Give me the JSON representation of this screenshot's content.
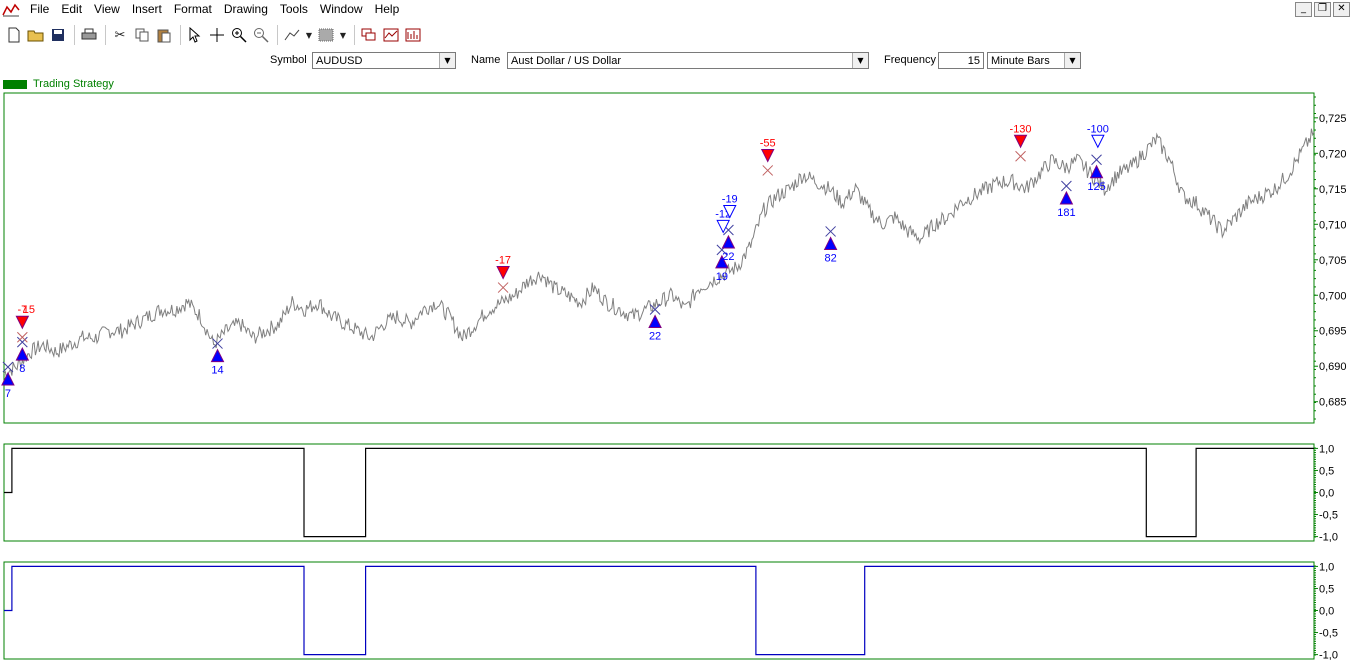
{
  "app": {
    "title_icon": "chart-app-icon"
  },
  "menu": {
    "items": [
      {
        "label": "File"
      },
      {
        "label": "Edit"
      },
      {
        "label": "View"
      },
      {
        "label": "Insert"
      },
      {
        "label": "Format"
      },
      {
        "label": "Drawing"
      },
      {
        "label": "Tools"
      },
      {
        "label": "Window"
      },
      {
        "label": "Help"
      }
    ]
  },
  "window_controls": {
    "minimize": "_",
    "restore": "❐",
    "close": "✕"
  },
  "symbol_bar": {
    "symbol_label": "Symbol",
    "symbol_value": "AUDUSD",
    "name_label": "Name",
    "name_value": "Aust Dollar / US Dollar",
    "frequency_label": "Frequency",
    "frequency_value": "15",
    "bar_type_value": "Minute Bars"
  },
  "strategy": {
    "label": "Trading Strategy",
    "color": "#008000"
  },
  "colors": {
    "price": "#808080",
    "frame": "#008000",
    "buy": "#0000ff",
    "sell": "#ff0000",
    "indicator1": "#000000",
    "indicator2": "#0000c0"
  },
  "chart_data": [
    {
      "type": "line",
      "name": "price",
      "y_ticks": [
        "0,725",
        "0,720",
        "0,715",
        "0,710",
        "0,705",
        "0,700",
        "0,695",
        "0,690",
        "0,685"
      ],
      "ylim": [
        0.682,
        0.7285
      ],
      "x_index_range": [
        0,
        100
      ],
      "series": [
        {
          "x": [
            0,
            1,
            2,
            3,
            4,
            5,
            6,
            7,
            8,
            9,
            10,
            11,
            12,
            13,
            14,
            15,
            16,
            17,
            18,
            19,
            20,
            21,
            22,
            23,
            24,
            25,
            26,
            27,
            28,
            29,
            30,
            31,
            32,
            33,
            34,
            35,
            36,
            37,
            38,
            39,
            40,
            41,
            42,
            43,
            44,
            45,
            46,
            47,
            48,
            49,
            50,
            51,
            52,
            53,
            54,
            55,
            56,
            57,
            58,
            59,
            60,
            61,
            62,
            63,
            64,
            65,
            66,
            67,
            68,
            69,
            70,
            71,
            72,
            73,
            74,
            75,
            76,
            77,
            78,
            79,
            80,
            81,
            82,
            83,
            84,
            85,
            86,
            87,
            88,
            89,
            90,
            91,
            92,
            93,
            94,
            95,
            96,
            97,
            98,
            99,
            100
          ],
          "values": [
            0.689,
            0.69,
            0.692,
            0.693,
            0.692,
            0.693,
            0.694,
            0.694,
            0.695,
            0.695,
            0.696,
            0.697,
            0.698,
            0.698,
            0.699,
            0.697,
            0.693,
            0.695,
            0.696,
            0.694,
            0.695,
            0.696,
            0.699,
            0.698,
            0.699,
            0.697,
            0.696,
            0.695,
            0.694,
            0.696,
            0.697,
            0.696,
            0.698,
            0.699,
            0.697,
            0.694,
            0.696,
            0.698,
            0.699,
            0.7,
            0.702,
            0.703,
            0.701,
            0.7,
            0.699,
            0.701,
            0.699,
            0.698,
            0.697,
            0.698,
            0.699,
            0.7,
            0.698,
            0.701,
            0.702,
            0.703,
            0.704,
            0.707,
            0.712,
            0.714,
            0.715,
            0.717,
            0.716,
            0.715,
            0.713,
            0.715,
            0.712,
            0.71,
            0.711,
            0.709,
            0.708,
            0.71,
            0.711,
            0.713,
            0.714,
            0.715,
            0.716,
            0.716,
            0.715,
            0.717,
            0.719,
            0.718,
            0.719,
            0.717,
            0.715,
            0.717,
            0.718,
            0.72,
            0.722,
            0.719,
            0.714,
            0.713,
            0.711,
            0.709,
            0.711,
            0.713,
            0.714,
            0.715,
            0.717,
            0.72,
            0.723
          ]
        }
      ],
      "markers": [
        {
          "x": 0.3,
          "y": 0.6882,
          "kind": "buy",
          "label": "7"
        },
        {
          "x": 1.4,
          "y": 0.6917,
          "kind": "buy",
          "label": "8"
        },
        {
          "x": 1.4,
          "y": 0.6962,
          "kind": "sell",
          "label": "-7"
        },
        {
          "x": 1.9,
          "y": 0.6962,
          "kind": "none",
          "label": "15"
        },
        {
          "x": 16.3,
          "y": 0.6915,
          "kind": "buy",
          "label": "14"
        },
        {
          "x": 38.1,
          "y": 0.7032,
          "kind": "sell",
          "label": "-17"
        },
        {
          "x": 49.7,
          "y": 0.6963,
          "kind": "buy",
          "label": "22"
        },
        {
          "x": 54.8,
          "y": 0.7047,
          "kind": "buy",
          "label": "19"
        },
        {
          "x": 55.3,
          "y": 0.7075,
          "kind": "buy",
          "label": "22"
        },
        {
          "x": 54.9,
          "y": 0.7097,
          "kind": "exit",
          "label": "-12"
        },
        {
          "x": 55.4,
          "y": 0.7118,
          "kind": "exit",
          "label": "-19"
        },
        {
          "x": 58.3,
          "y": 0.7197,
          "kind": "sell",
          "label": "-55"
        },
        {
          "x": 63.1,
          "y": 0.7073,
          "kind": "buy",
          "label": "82"
        },
        {
          "x": 77.6,
          "y": 0.7217,
          "kind": "sell",
          "label": "-130"
        },
        {
          "x": 81.1,
          "y": 0.7137,
          "kind": "buy",
          "label": "181"
        },
        {
          "x": 83.4,
          "y": 0.7174,
          "kind": "buy",
          "label": "125"
        },
        {
          "x": 83.5,
          "y": 0.7217,
          "kind": "exit",
          "label": "-100"
        }
      ]
    },
    {
      "type": "line",
      "name": "position-1",
      "y_ticks": [
        "1,0",
        "0,5",
        "0,0",
        "-0,5",
        "-1,0"
      ],
      "ylim": [
        -1.1,
        1.1
      ],
      "x_index_range": [
        0,
        100
      ],
      "series": [
        {
          "x": [
            0,
            0.6,
            0.6,
            22.9,
            22.9,
            27.6,
            27.6,
            87.2,
            87.2,
            91.0,
            91.0,
            100
          ],
          "values": [
            0,
            0,
            1,
            1,
            -1,
            -1,
            1,
            1,
            -1,
            -1,
            1,
            1
          ]
        }
      ]
    },
    {
      "type": "line",
      "name": "position-2",
      "y_ticks": [
        "1,0",
        "0,5",
        "0,0",
        "-0,5",
        "-1,0"
      ],
      "ylim": [
        -1.1,
        1.1
      ],
      "x_index_range": [
        0,
        100
      ],
      "series": [
        {
          "x": [
            0,
            0.6,
            0.6,
            22.9,
            22.9,
            27.6,
            27.6,
            57.4,
            57.4,
            65.7,
            65.7,
            100
          ],
          "values": [
            0,
            0,
            1,
            1,
            -1,
            -1,
            1,
            1,
            -1,
            -1,
            1,
            1
          ]
        }
      ]
    }
  ]
}
